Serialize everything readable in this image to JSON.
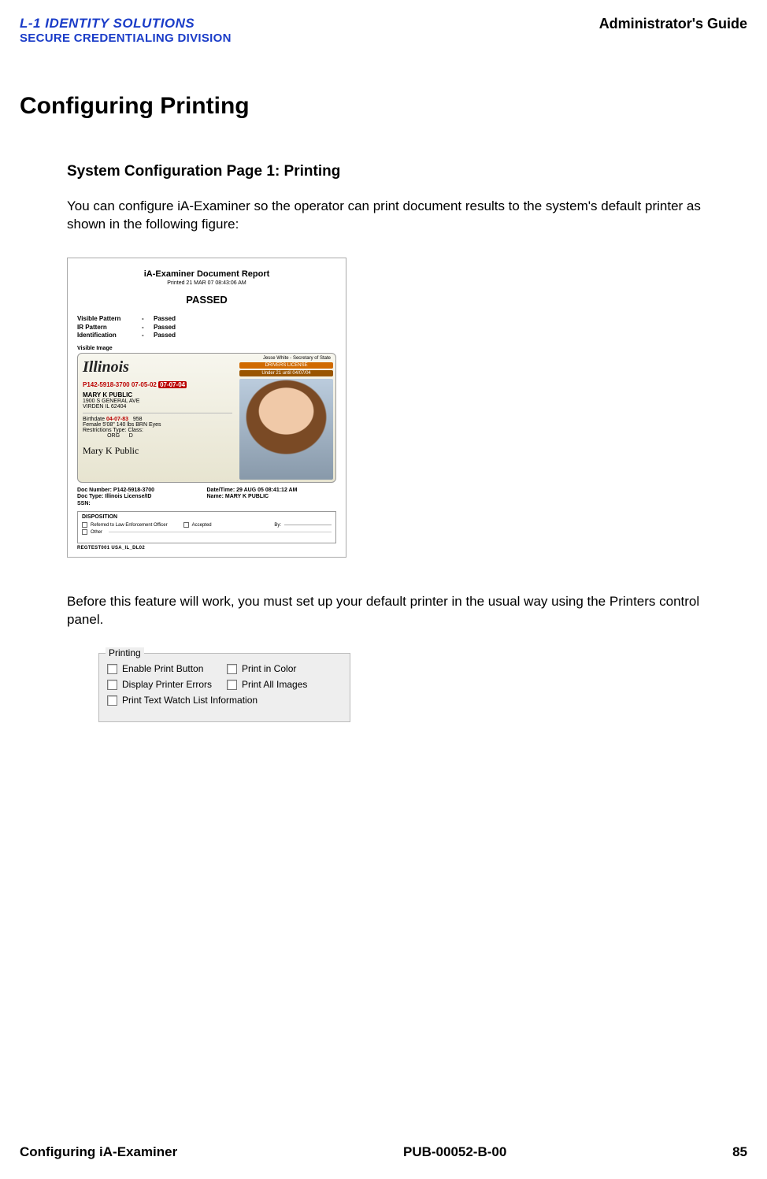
{
  "header": {
    "logo_line1": "L-1 IDENTITY SOLUTIONS",
    "logo_line2": "SECURE CREDENTIALING DIVISION",
    "right": "Administrator's Guide"
  },
  "h1": "Configuring Printing",
  "h2": "System Configuration Page 1: Printing",
  "para1": "You can configure iA-Examiner so the operator can print document results to the system's default printer as shown in the following figure:",
  "para2": "Before this feature will work, you must set up your default printer in the usual way using the Printers control panel.",
  "report": {
    "title": "iA-Examiner Document Report",
    "printed": "Printed  21 MAR 07  08:43:06 AM",
    "status": "PASSED",
    "results": [
      {
        "label": "Visible Pattern",
        "value": "Passed"
      },
      {
        "label": "IR Pattern",
        "value": "Passed"
      },
      {
        "label": "Identification",
        "value": "Passed"
      }
    ],
    "visible_image_label": "Visible Image",
    "license": {
      "state": "Illinois",
      "secretary": "Jesse White - Secretary of State",
      "number_line": "P142-5918-3700 07-05-02",
      "exp_tag": "07-07-04",
      "drivers_license": "DRIVERS LICENSE",
      "under21": "Under 21 until 04/07/04",
      "name": "MARY K PUBLIC",
      "addr1": "1900 S GENERAL AVE",
      "addr2": "VIRDEN IL 62404",
      "birthdate_label": "Birthdate",
      "birthdate": "04-07-83",
      "ssn": "958",
      "detail_line": "Female   5'08\"  140 lbs    BRN Eyes",
      "restrictions_line": "Restrictions    Type:    Class:",
      "restrictions_vals": "                ORG      D",
      "signature": "Mary K Public"
    },
    "meta": {
      "doc_number_label": "Doc Number:",
      "doc_number": "P142-5918-3700",
      "datetime_label": "Date/Time:",
      "datetime": "29 AUG 05  08:41:12 AM",
      "doc_type_label": "Doc Type:",
      "doc_type": "Illinois License/ID",
      "name_label": "Name:",
      "name": "MARY K PUBLIC",
      "ssn_label": "SSN:"
    },
    "disposition": {
      "title": "DISPOSITION",
      "opt1": "Referred to Law Enforcement Officer",
      "opt2": "Accepted",
      "opt3": "Other",
      "by": "By:"
    },
    "footer": "REGTEST001   USA_IL_DL02"
  },
  "groupbox": {
    "legend": "Printing",
    "items": {
      "enable": "Enable Print Button",
      "color": "Print in Color",
      "errors": "Display Printer Errors",
      "allimages": "Print All Images",
      "watchlist": "Print Text Watch List Information"
    }
  },
  "footer": {
    "left": "Configuring iA-Examiner",
    "center": "PUB-00052-B-00",
    "right": "85"
  }
}
